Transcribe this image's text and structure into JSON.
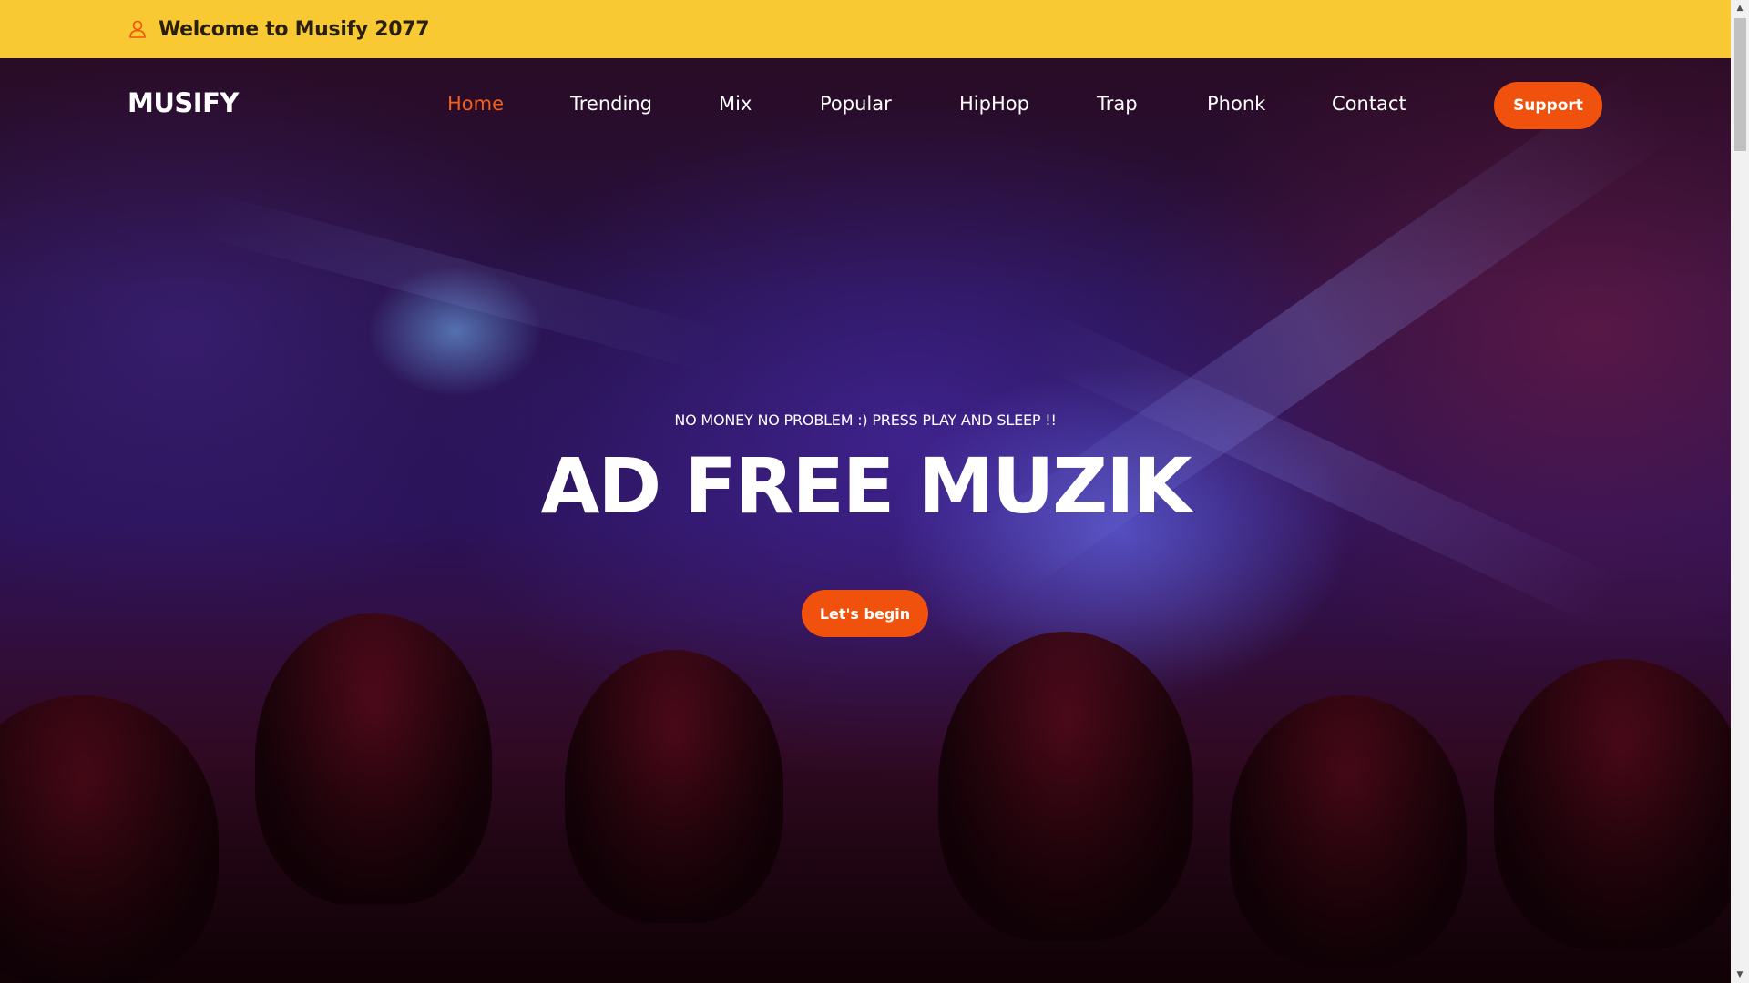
{
  "topbar": {
    "icon": "user-icon",
    "welcome_text": "Welcome to Musify 2077",
    "background_color": "#f9c933",
    "icon_color": "#f0520e"
  },
  "navbar": {
    "logo": "MUSIFY",
    "links": [
      {
        "label": "Home",
        "active": true
      },
      {
        "label": "Trending",
        "active": false
      },
      {
        "label": "Mix",
        "active": false
      },
      {
        "label": "Popular",
        "active": false
      },
      {
        "label": "HipHop",
        "active": false
      },
      {
        "label": "Trap",
        "active": false
      },
      {
        "label": "Phonk",
        "active": false
      },
      {
        "label": "Contact",
        "active": false
      }
    ],
    "support_label": "Support",
    "active_color": "#f2601a"
  },
  "hero": {
    "tagline": "NO MONEY NO PROBLEM :) PRESS PLAY AND SLEEP !!",
    "headline": "AD FREE MUZIK",
    "cta_label": "Let's begin",
    "accent_color": "#f0520e"
  },
  "scrollbar": {
    "up_icon": "scroll-up-arrow-icon",
    "down_icon": "scroll-down-arrow-icon"
  }
}
